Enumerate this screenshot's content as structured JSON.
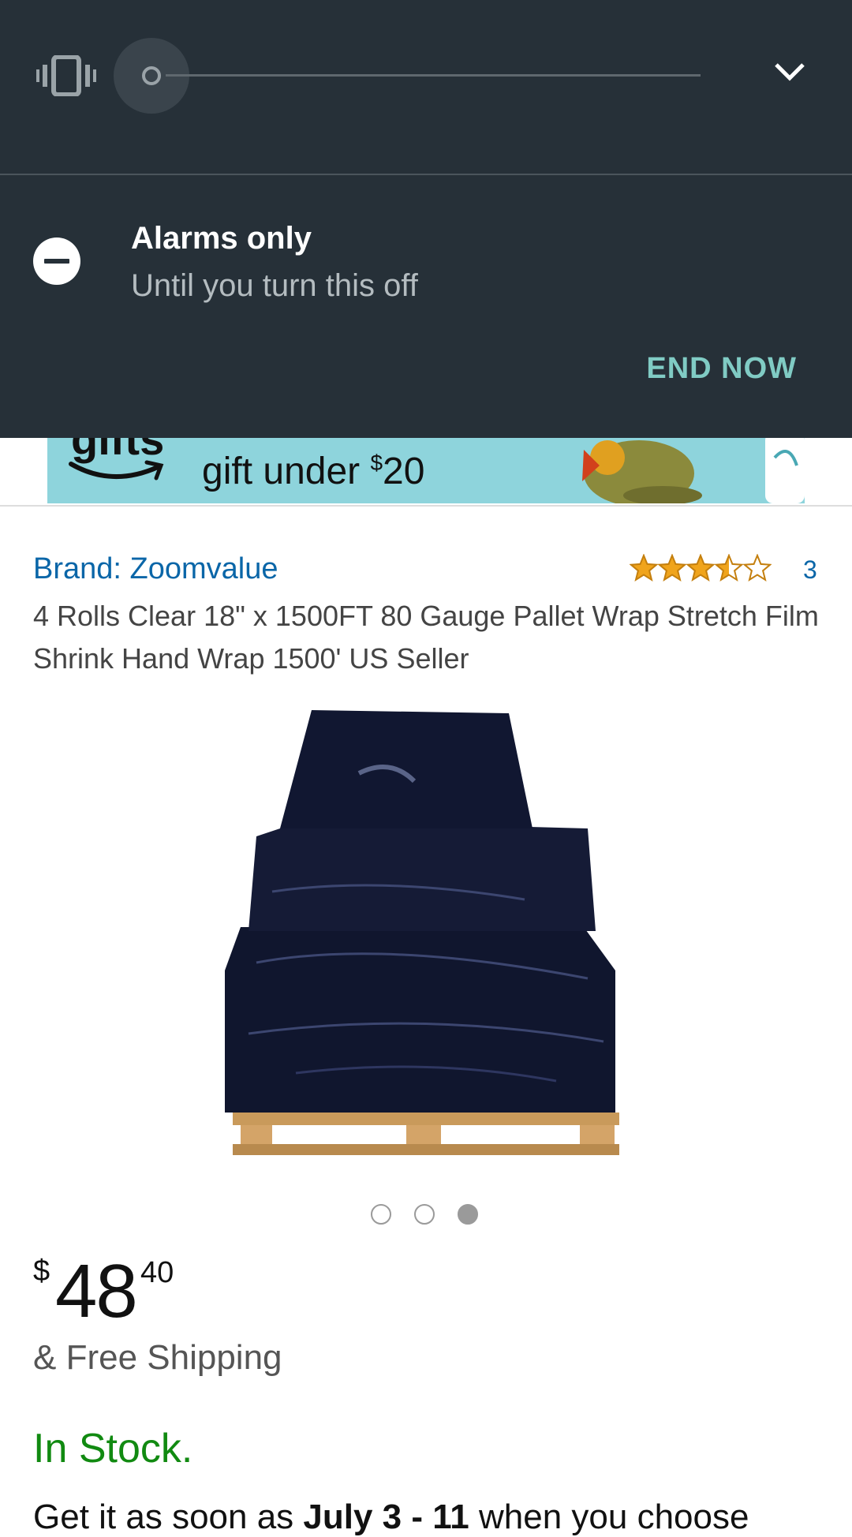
{
  "shade": {
    "volume_level": 0.0,
    "dnd_title": "Alarms only",
    "dnd_subtitle": "Until you turn this off",
    "end_now": "END NOW"
  },
  "banner": {
    "gifts_text": "gifts",
    "text_main": "gift under ",
    "text_currency": "$",
    "text_amount": "20"
  },
  "product": {
    "brand": "Brand: Zoomvalue",
    "rating": 3.5,
    "rating_count": "3",
    "title": "4 Rolls Clear 18\" x 1500FT 80 Gauge Pallet Wrap Stretch Film Shrink Hand Wrap 1500' US Seller",
    "image_count": 3,
    "active_image": 3,
    "price_symbol": "$",
    "price_whole": "48",
    "price_fraction": "40",
    "shipping": "& Free Shipping",
    "stock": "In Stock.",
    "delivery_prefix": "Get it as soon as ",
    "delivery_dates": "July 3 - 11",
    "delivery_suffix": " when you choose"
  },
  "colors": {
    "shade_bg": "#263038",
    "accent_teal": "#80cbc4",
    "link_blue": "#0a66a8",
    "stock_green": "#118a11",
    "star_orange": "#f0a41c"
  }
}
